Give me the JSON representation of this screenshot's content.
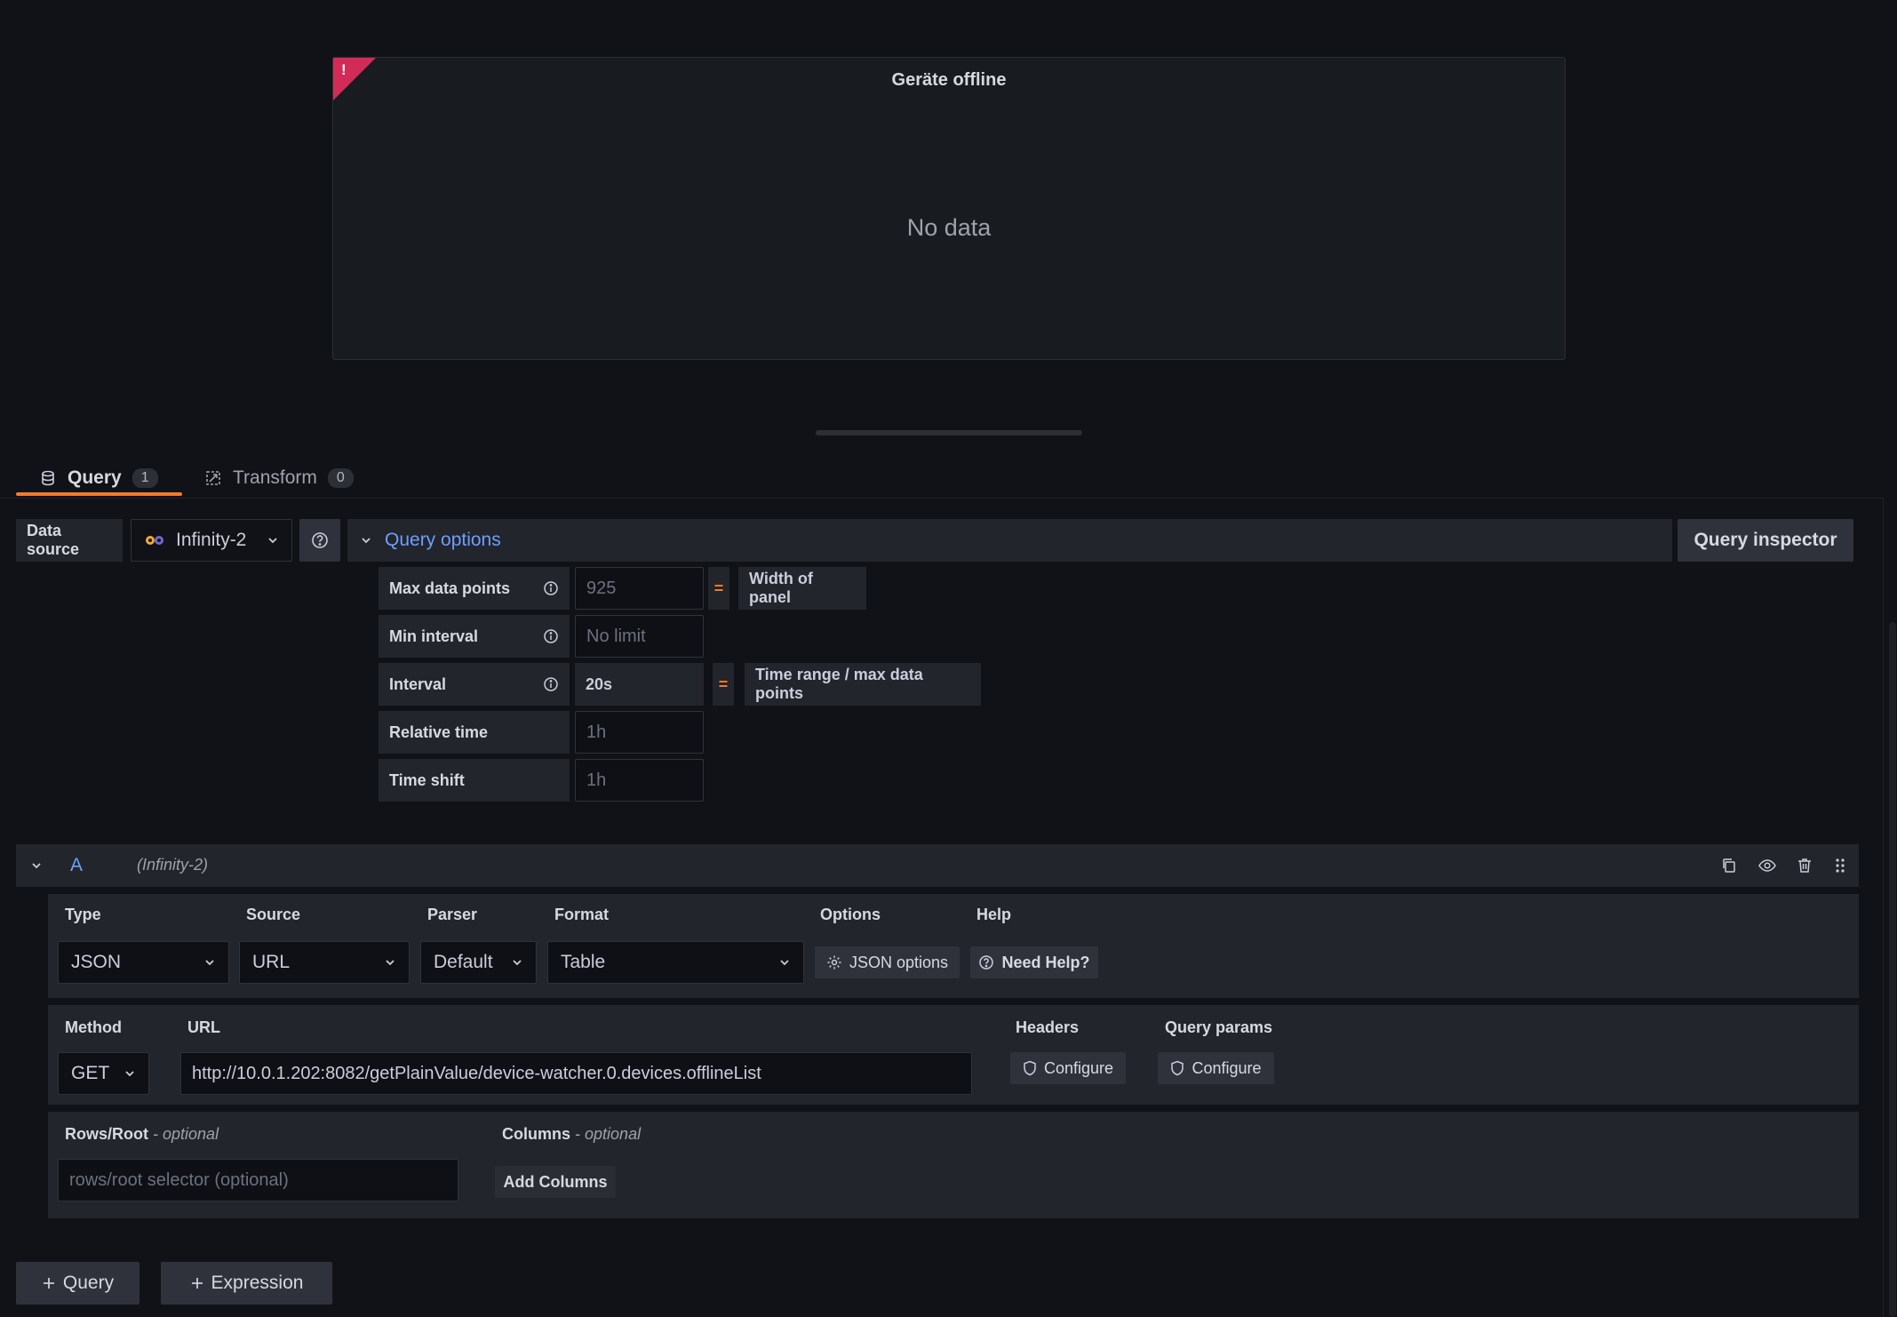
{
  "panel": {
    "title": "Geräte offline",
    "no_data": "No data",
    "alert_mark": "!"
  },
  "tabs": [
    {
      "label": "Query",
      "count": "1",
      "active": true
    },
    {
      "label": "Transform",
      "count": "0",
      "active": false
    }
  ],
  "datasource": {
    "label": "Data source",
    "value": "Infinity-2"
  },
  "query_options": {
    "title": "Query options",
    "inspector": "Query inspector",
    "rows": [
      {
        "label": "Max data points",
        "value": "925",
        "placeholder": true,
        "eq": "=",
        "note": "Width of panel"
      },
      {
        "label": "Min interval",
        "value": "No limit",
        "placeholder": true
      },
      {
        "label": "Interval",
        "value": "20s",
        "placeholder": false,
        "eq": "=",
        "note": "Time range / max data points"
      },
      {
        "label": "Relative time",
        "value": "1h",
        "placeholder": true
      },
      {
        "label": "Time shift",
        "value": "1h",
        "placeholder": true
      }
    ]
  },
  "query_a": {
    "letter": "A",
    "datasource": "(Infinity-2)",
    "type_label": "Type",
    "type_value": "JSON",
    "source_label": "Source",
    "source_value": "URL",
    "parser_label": "Parser",
    "parser_value": "Default",
    "format_label": "Format",
    "format_value": "Table",
    "options_label": "Options",
    "json_options": "JSON options",
    "help_label": "Help",
    "need_help": "Need Help?",
    "method_label": "Method",
    "method_value": "GET",
    "url_label": "URL",
    "url_value": "http://10.0.1.202:8082/getPlainValue/device-watcher.0.devices.offlineList",
    "headers_label": "Headers",
    "headers_btn": "Configure",
    "params_label": "Query params",
    "params_btn": "Configure",
    "rows_root_label": "Rows/Root",
    "optional": "- optional",
    "rows_root_placeholder": "rows/root selector (optional)",
    "columns_label": "Columns",
    "add_columns": "Add Columns"
  },
  "footer": {
    "add_query": "Query",
    "add_expression": "Expression"
  },
  "colors": {
    "accent": "#f5792a",
    "link": "#6e9fff",
    "alert": "#d12b57"
  }
}
